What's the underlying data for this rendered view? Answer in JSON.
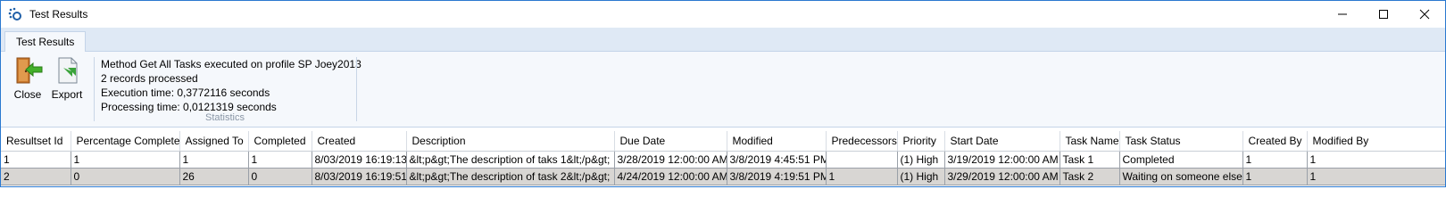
{
  "window": {
    "title": "Test Results"
  },
  "ribbon": {
    "tab": "Test Results",
    "close_label": "Close",
    "export_label": "Export",
    "stats": {
      "line1": "Method Get All Tasks executed on profile SP Joey2013",
      "line2": "2 records processed",
      "line3": "Execution time: 0,3772116 seconds",
      "line4": "Processing time: 0,0121319 seconds",
      "group_label": "Statistics"
    }
  },
  "grid": {
    "columns": [
      "Resultset Id",
      "Percentage Complete",
      "Assigned To",
      "Completed",
      "Created",
      "Description",
      "Due Date",
      "Modified",
      "Predecessors",
      "Priority",
      "Start Date",
      "Task Name",
      "Task Status",
      "Created By",
      "Modified By"
    ],
    "rows": [
      [
        "1",
        "1",
        "1",
        "1",
        "8/03/2019 16:19:13",
        "&lt;p&gt;The description of taks 1&lt;/p&gt;",
        "3/28/2019 12:00:00 AM",
        "3/8/2019 4:45:51 PM",
        "",
        "(1) High",
        "3/19/2019 12:00:00 AM",
        "Task 1",
        "Completed",
        "1",
        "1"
      ],
      [
        "2",
        "0",
        "26",
        "0",
        "8/03/2019 16:19:51",
        "&lt;p&gt;The description of task 2&lt;/p&gt;",
        "4/24/2019 12:00:00 AM",
        "3/8/2019 4:19:51 PM",
        "1",
        "(1) High",
        "3/29/2019 12:00:00 AM",
        "Task 2",
        "Waiting on someone else",
        "1",
        "1"
      ]
    ]
  }
}
